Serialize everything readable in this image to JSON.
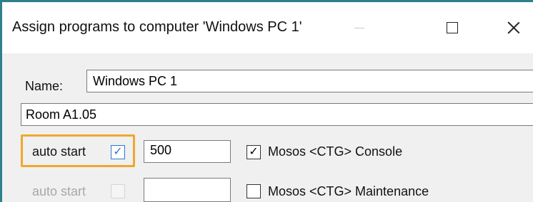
{
  "window": {
    "title": "Assign programs to computer 'Windows PC 1'",
    "accent_color": "#2f7f8c",
    "buttons": {
      "minimize_icon": "minimize-icon",
      "maximize_icon": "maximize-icon",
      "close_icon": "close-icon"
    }
  },
  "form": {
    "name_label": "Name:",
    "name_value": "Windows PC 1",
    "description_value": "Room A1.05"
  },
  "programs": [
    {
      "auto_start_label": "auto start",
      "auto_start_checked": true,
      "auto_start_enabled": true,
      "delay_value": "500",
      "program_checked": true,
      "program_name": "Mosos <CTG> Console",
      "highlighted": true,
      "highlight_color": "#f0a72e"
    },
    {
      "auto_start_label": "auto start",
      "auto_start_checked": false,
      "auto_start_enabled": false,
      "delay_value": "",
      "program_checked": false,
      "program_name": "Mosos <CTG> Maintenance",
      "highlighted": false
    }
  ],
  "glyphs": {
    "check": "✓"
  }
}
